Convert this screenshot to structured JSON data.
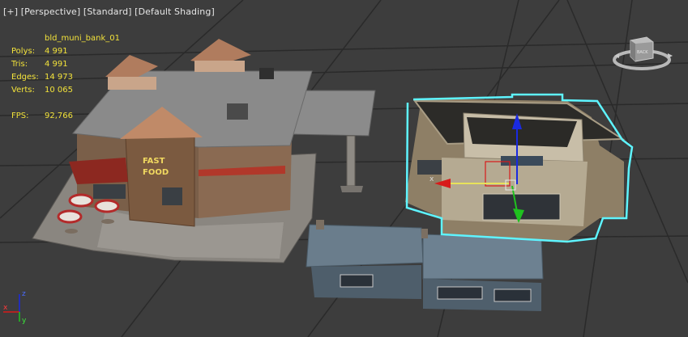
{
  "viewport": {
    "label_parts": [
      "[+]",
      "[Perspective]",
      "[Standard]",
      "[Default Shading]"
    ]
  },
  "stats": {
    "object_name": "bld_muni_bank_01",
    "rows": [
      {
        "label": "Polys:",
        "value": "4 991"
      },
      {
        "label": "Tris:",
        "value": "4 991"
      },
      {
        "label": "Edges:",
        "value": "14 973"
      },
      {
        "label": "Verts:",
        "value": "10 065"
      },
      {
        "label": "FPS:",
        "value": "92,766"
      }
    ]
  },
  "viewcube": {
    "face_label": "BACK"
  },
  "signage": {
    "fast_food_line1": "FAST",
    "fast_food_line2": "FOOD"
  },
  "axis_tripod": {
    "x": "x",
    "y": "y",
    "z": "z"
  },
  "gizmo": {
    "x_label": "x"
  },
  "colors": {
    "viewport_bg": "#3d3d3d",
    "grid": "#2a2a2a",
    "stats_text": "#f2e23a",
    "selection_outline": "#5ef4ff",
    "axis_x": "#d81a1a",
    "axis_y": "#1fc21f",
    "axis_z": "#1a2ae0"
  }
}
